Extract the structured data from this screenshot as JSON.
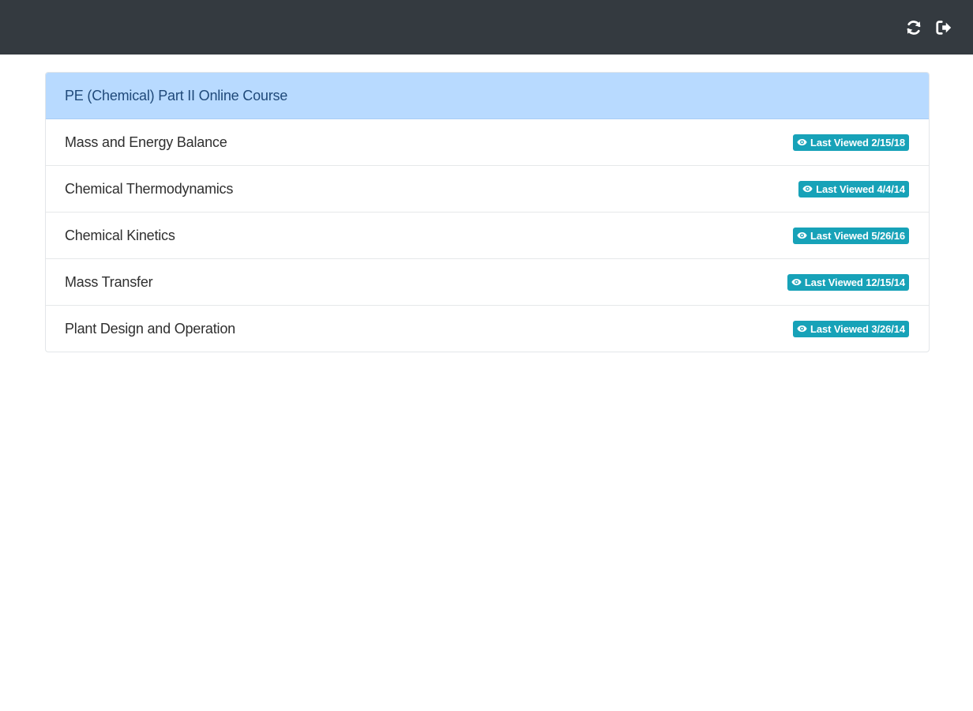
{
  "topbar": {
    "icons": [
      "refresh-icon",
      "logout-icon"
    ],
    "background": "#343a40"
  },
  "course": {
    "title": "PE (Chemical) Part II Online Course",
    "header_color": "#b8daff"
  },
  "badge": {
    "icon": "eye-icon",
    "color": "#17a2b8"
  },
  "modules": [
    {
      "label": "Mass and Energy Balance",
      "last_viewed": "Last Viewed 2/15/18"
    },
    {
      "label": "Chemical Thermodynamics",
      "last_viewed": "Last Viewed 4/4/14"
    },
    {
      "label": "Chemical Kinetics",
      "last_viewed": "Last Viewed 5/26/16"
    },
    {
      "label": "Mass Transfer",
      "last_viewed": "Last Viewed 12/15/14"
    },
    {
      "label": "Plant Design and Operation",
      "last_viewed": "Last Viewed 3/26/14"
    }
  ]
}
